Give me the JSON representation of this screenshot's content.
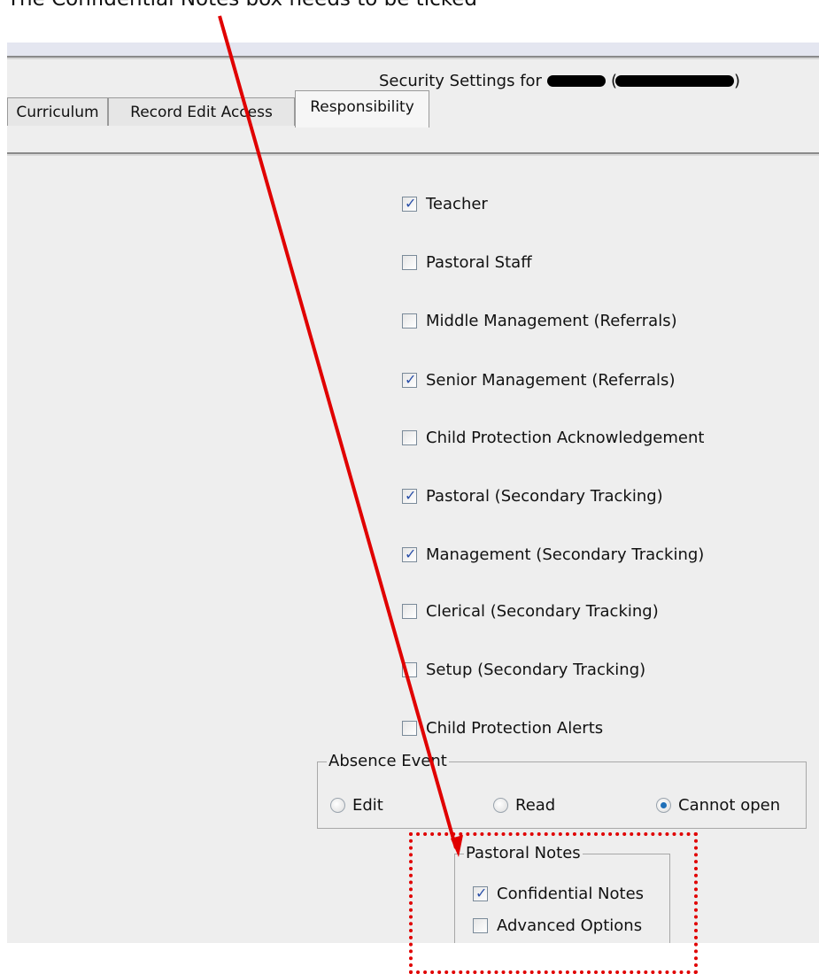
{
  "caption": "The Confidential Notes box needs to be ticked",
  "header": {
    "security_label": "Security Settings for",
    "open_paren": "(",
    "close_paren": ")"
  },
  "tabs": [
    {
      "label": "Curriculum",
      "active": false
    },
    {
      "label": "Record Edit Access",
      "active": false
    },
    {
      "label": "Responsibility",
      "active": true
    }
  ],
  "responsibilities": [
    {
      "label": "Teacher",
      "checked": true
    },
    {
      "label": "Pastoral Staff",
      "checked": false
    },
    {
      "label": "Middle Management (Referrals)",
      "checked": false
    },
    {
      "label": "Senior Management (Referrals)",
      "checked": true
    },
    {
      "label": "Child Protection Acknowledgement",
      "checked": false
    },
    {
      "label": "Pastoral (Secondary Tracking)",
      "checked": true
    },
    {
      "label": "Management (Secondary Tracking)",
      "checked": true
    },
    {
      "label": "Clerical (Secondary Tracking)",
      "checked": false
    },
    {
      "label": "Setup (Secondary Tracking)",
      "checked": false
    },
    {
      "label": "Child Protection Alerts",
      "checked": false
    }
  ],
  "absence_event": {
    "title": "Absence Event",
    "options": [
      {
        "label": "Edit",
        "selected": false
      },
      {
        "label": "Read",
        "selected": false
      },
      {
        "label": "Cannot open",
        "selected": true
      }
    ]
  },
  "pastoral_notes": {
    "title": "Pastoral Notes",
    "options": [
      {
        "label": "Confidential Notes",
        "checked": true
      },
      {
        "label": "Advanced Options",
        "checked": false
      }
    ]
  },
  "annotation": {
    "arrow_color": "#e00000",
    "highlight_color": "#e00000"
  }
}
